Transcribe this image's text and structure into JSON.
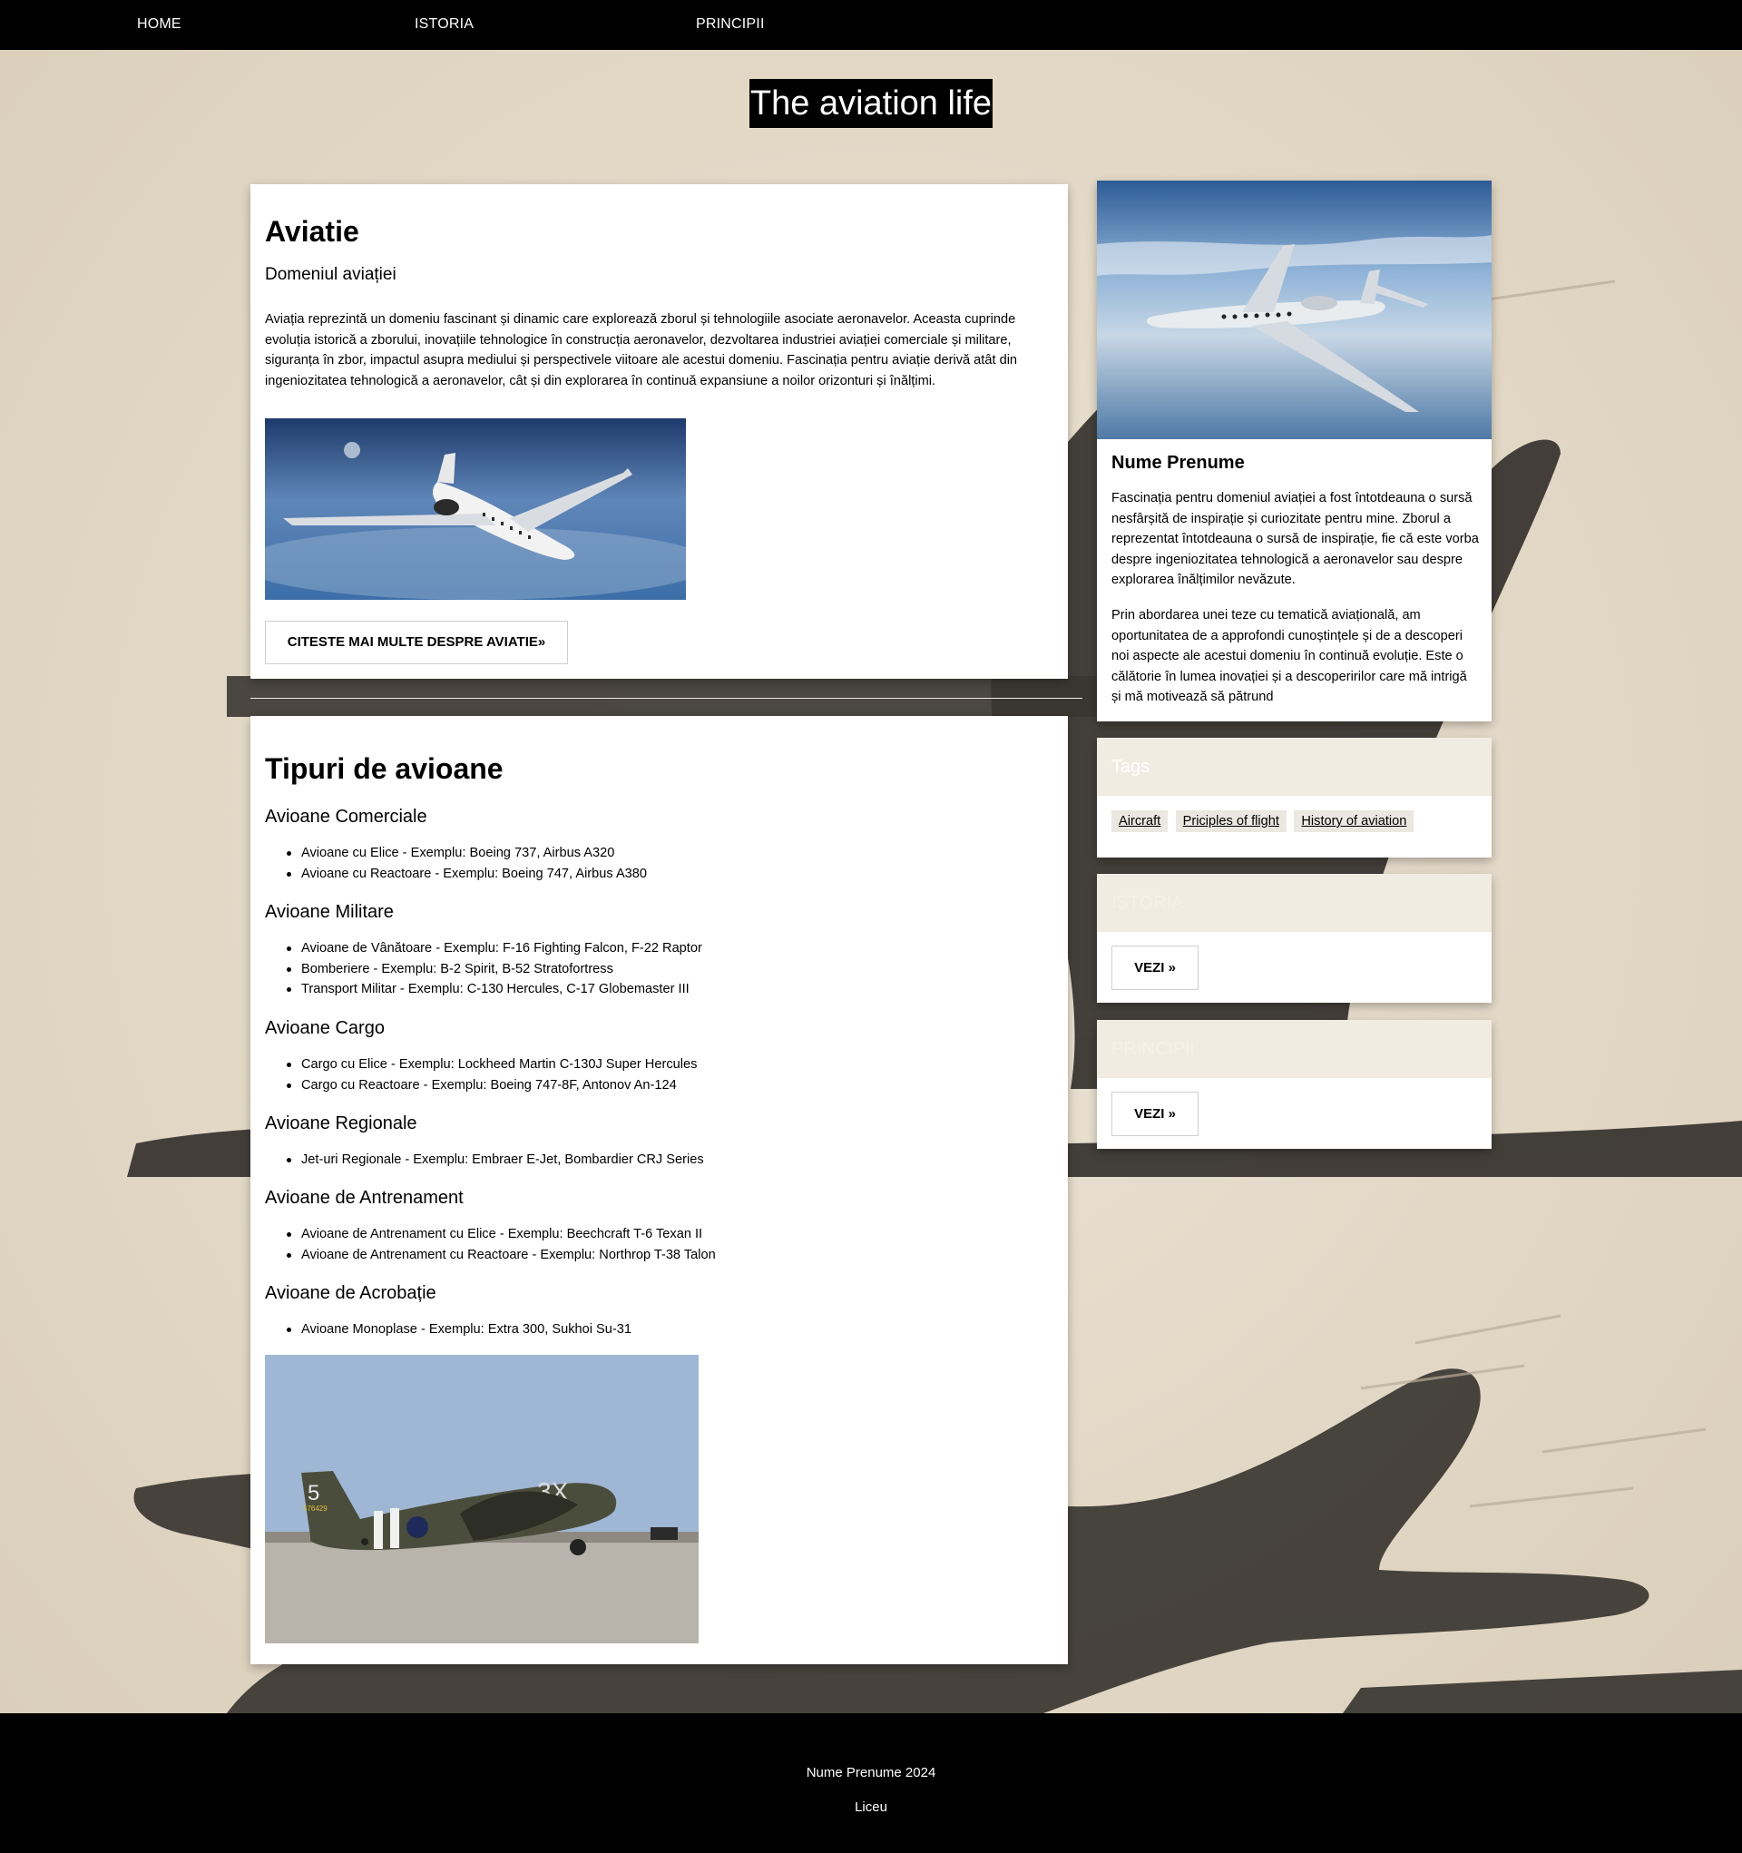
{
  "nav": {
    "home": "HOME",
    "istoria": "ISTORIA",
    "principii": "PRINCIPII"
  },
  "site_title": "The aviation life",
  "aviatie": {
    "title": "Aviatie",
    "subtitle": "Domeniul aviației",
    "description": "Aviația reprezintă un domeniu fascinant și dinamic care explorează zborul și tehnologiile asociate aeronavelor. Aceasta cuprinde evoluția istorică a zborului, inovațiile tehnologice în construcția aeronavelor, dezvoltarea industriei aviației comerciale și militare, siguranța în zbor, impactul asupra mediului și perspectivele viitoare ale acestui domeniu. Fascinația pentru aviație derivă atât din ingeniozitatea tehnologică a aeronavelor, cât și din explorarea în continuă expansiune a noilor orizonturi și înălțimi.",
    "button": "CITESTE MAI MULTE DESPRE AVIATIE»"
  },
  "tipuri": {
    "title": "Tipuri de avioane",
    "sections": [
      {
        "heading": "Avioane Comerciale",
        "items": [
          "Avioane cu Elice - Exemplu: Boeing 737, Airbus A320",
          "Avioane cu Reactoare - Exemplu: Boeing 747, Airbus A380"
        ]
      },
      {
        "heading": "Avioane Militare",
        "items": [
          "Avioane de Vânătoare - Exemplu: F-16 Fighting Falcon, F-22 Raptor",
          "Bomberiere - Exemplu: B-2 Spirit, B-52 Stratofortress",
          "Transport Militar - Exemplu: C-130 Hercules, C-17 Globemaster III"
        ]
      },
      {
        "heading": "Avioane Cargo",
        "items": [
          "Cargo cu Elice - Exemplu: Lockheed Martin C-130J Super Hercules",
          "Cargo cu Reactoare - Exemplu: Boeing 747-8F, Antonov An-124"
        ]
      },
      {
        "heading": "Avioane Regionale",
        "items": [
          "Jet-uri Regionale - Exemplu: Embraer E-Jet, Bombardier CRJ Series"
        ]
      },
      {
        "heading": "Avioane de Antrenament",
        "items": [
          "Avioane de Antrenament cu Elice - Exemplu: Beechcraft T-6 Texan II",
          "Avioane de Antrenament cu Reactoare - Exemplu: Northrop T-38 Talon"
        ]
      },
      {
        "heading": "Avioane de Acrobație",
        "items": [
          "Avioane Monoplase - Exemplu: Extra 300, Sukhoi Su-31"
        ]
      }
    ],
    "photo_markings": {
      "tail": "5",
      "serial": "476429",
      "nose": "3X"
    }
  },
  "profile": {
    "name": "Nume Prenume",
    "p1": "Fascinația pentru domeniul aviației a fost întotdeauna o sursă nesfârșită de inspirație și curiozitate pentru mine. Zborul a reprezentat întotdeauna o sursă de inspirație, fie că este vorba despre ingeniozitatea tehnologică a aeronavelor sau despre explorarea înălțimilor nevăzute.",
    "p2": "Prin abordarea unei teze cu tematică aviațională, am oportunitatea de a approfondi cunoștințele și de a descoperi noi aspecte ale acestui domeniu în continuă evoluție. Este o călătorie în lumea inovației și a descoperirilor care mă intrigă și mă motivează să pătrund"
  },
  "tags": {
    "title": "Tags",
    "items": [
      "Aircraft",
      "Priciples of flight",
      "History of aviation"
    ]
  },
  "istoria_box": {
    "title": "ISTORIA",
    "button": "VEZI »"
  },
  "principii_box": {
    "title": "PRINCIPII",
    "button": "VEZI »"
  },
  "footer": {
    "line1": "Nume Prenume 2024",
    "line2": "Liceu"
  },
  "colors": {
    "nav_bg": "#000000",
    "page_bg": "#e6dccb",
    "card_bg": "#ffffff",
    "plane_silhouette": "#3a3631"
  }
}
